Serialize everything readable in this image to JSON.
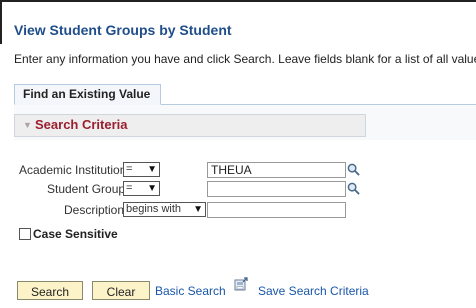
{
  "page": {
    "title": "View Student Groups by Student",
    "instructions": "Enter any information you have and click Search. Leave fields blank for a list of all values."
  },
  "tabs": [
    {
      "label": "Find an Existing Value",
      "active": true
    }
  ],
  "search_criteria": {
    "label": "Search Criteria",
    "fields": [
      {
        "label": "Academic Institution",
        "operator": "=",
        "value": ""
      },
      {
        "label": "Student Group",
        "operator": "=",
        "value": ""
      },
      {
        "label": "Description",
        "operator": "begins with",
        "value": ""
      }
    ],
    "institution_value": "THEUA",
    "case_sensitive_label": "Case Sensitive",
    "case_sensitive_checked": false
  },
  "actions": {
    "search_label": "Search",
    "clear_label": "Clear",
    "basic_search_label": "Basic Search",
    "save_search_label": "Save Search Criteria"
  },
  "colors": {
    "title": "#1f4e8a",
    "criteria_label": "#9a1f2e",
    "link": "#1a56a8",
    "button_bg": "#fdf3c9"
  }
}
